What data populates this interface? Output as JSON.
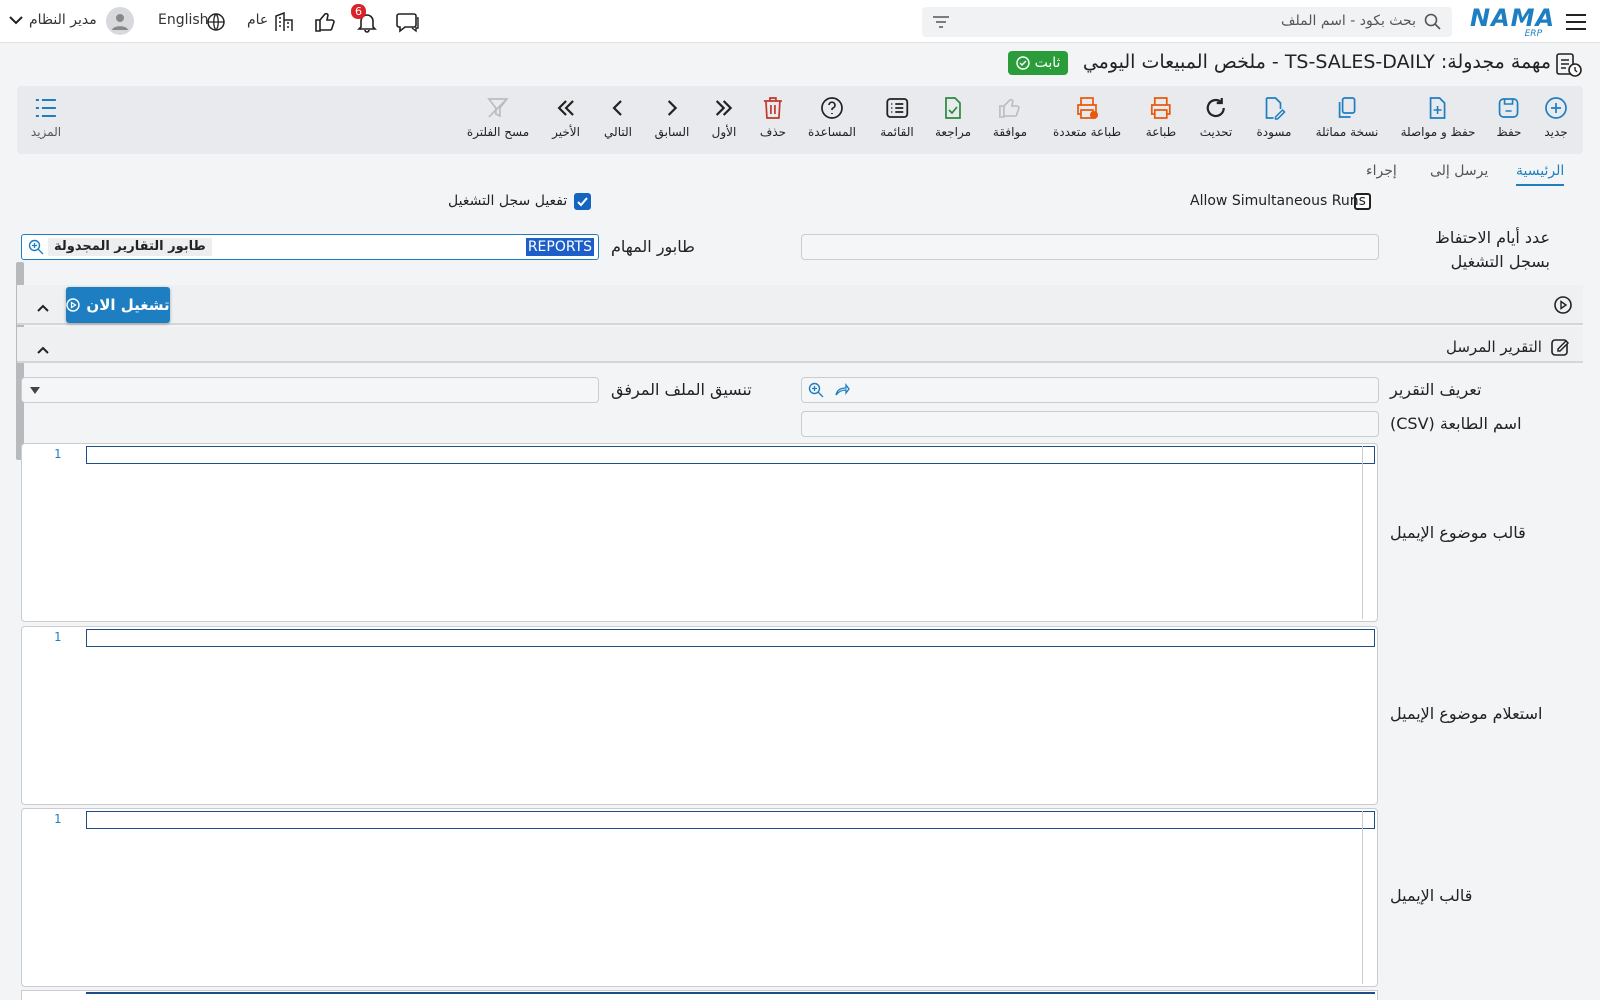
{
  "topbar": {
    "search_placeholder": "بحث بكود - اسم الملف",
    "logo_text": "NAMA",
    "logo_sub": "ERP",
    "user_name": "مدير النظام",
    "language": "English",
    "branch": "عام",
    "notifications_count": "6"
  },
  "header": {
    "title": "مهمة مجدولة: TS-SALES-DAILY - ملخص المبيعات اليومي",
    "status": "ثابت"
  },
  "toolbar": {
    "new": "جديد",
    "save": "حفظ",
    "save_continue": "حفظ و مواصلة",
    "duplicate": "نسخة مماثلة",
    "draft": "مسودة",
    "refresh": "تحديث",
    "print": "طباعة",
    "multi_print": "طباعة متعددة",
    "approve": "موافقة",
    "review": "مراجعة",
    "list": "القائمة",
    "help": "المساعدة",
    "delete": "حذف",
    "first": "الأول",
    "previous": "السابق",
    "next": "التالي",
    "last": "الأخير",
    "clear_filter": "مسح الفلترة",
    "more": "المزيد"
  },
  "tabs": {
    "main": "الرئيسية",
    "send_to": "يرسل إلى",
    "action": "إجراء"
  },
  "form": {
    "allow_simultaneous": "Allow Simultaneous Runs",
    "enable_run_log": "تفعيل سجل التشغيل",
    "retention_days_label": "عدد أيام الاحتفاظ بسجل التشغيل",
    "task_queue_label": "طابور المهام",
    "task_queue_code": "REPORTS",
    "task_queue_name": "طابور التقارير المجدولة",
    "run_now": "تشغيل الان",
    "sent_report_section": "التقرير المرسل",
    "report_definition_label": "تعريف التقرير",
    "attachment_format_label": "تنسيق الملف المرفق",
    "printer_name_label": "اسم الطابعة (CSV)",
    "email_subject_template_label": "قالب موضوع الإيميل",
    "email_subject_query_label": "استعلام موضوع الإيميل",
    "email_template_label": "قالب الإيميل",
    "line_number": "1"
  },
  "colors": {
    "accent": "#1d7fc2",
    "status_green": "#2a9d3a",
    "print_orange": "#e8590c",
    "review_green": "#2b8a3e",
    "delete_red": "#c0392b"
  }
}
